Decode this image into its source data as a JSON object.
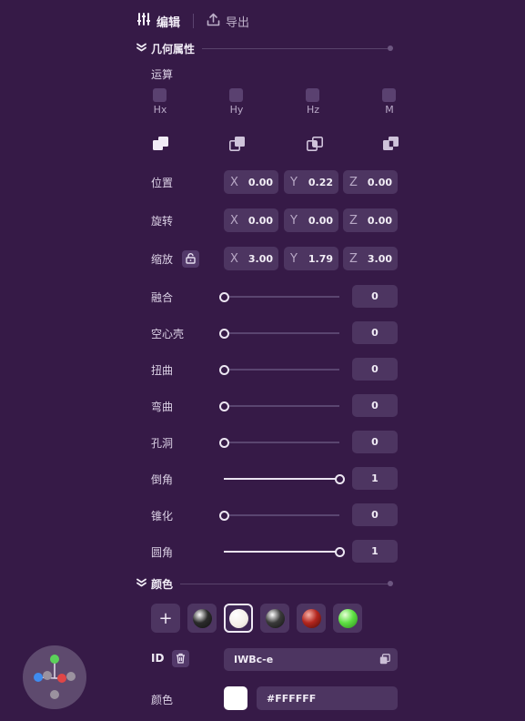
{
  "toolbar": {
    "edit_label": "编辑",
    "export_label": "导出"
  },
  "geometry": {
    "section_title": "几何属性",
    "operations_label": "运算",
    "operations": [
      "Hx",
      "Hy",
      "Hz",
      "M"
    ],
    "position": {
      "label": "位置",
      "x": "0.00",
      "y": "0.22",
      "z": "0.00"
    },
    "rotation": {
      "label": "旋转",
      "x": "0.00",
      "y": "0.00",
      "z": "0.00"
    },
    "scale": {
      "label": "缩放",
      "x": "3.00",
      "y": "1.79",
      "z": "3.00"
    },
    "axes": {
      "x": "X",
      "y": "Y",
      "z": "Z"
    },
    "sliders": [
      {
        "label": "融合",
        "value": "0",
        "level": 0
      },
      {
        "label": "空心壳",
        "value": "0",
        "level": 0
      },
      {
        "label": "扭曲",
        "value": "0",
        "level": 0
      },
      {
        "label": "弯曲",
        "value": "0",
        "level": 0
      },
      {
        "label": "孔洞",
        "value": "0",
        "level": 0
      },
      {
        "label": "倒角",
        "value": "1",
        "level": 1
      },
      {
        "label": "锥化",
        "value": "0",
        "level": 0
      },
      {
        "label": "圆角",
        "value": "1",
        "level": 1
      }
    ]
  },
  "color": {
    "section_title": "颜色",
    "add_label": "+",
    "swatches": [
      {
        "name": "dark-metal",
        "color": "#2b2b2b",
        "selected": false
      },
      {
        "name": "white",
        "color": "#ffffff",
        "selected": true
      },
      {
        "name": "dark-gray",
        "color": "#3a3a3a",
        "selected": false
      },
      {
        "name": "red",
        "color": "#b3261e",
        "selected": false
      },
      {
        "name": "green",
        "color": "#5ee043",
        "selected": false
      }
    ],
    "id_label": "ID",
    "id_value": "IWBc-e",
    "color_label": "颜色",
    "hex_value": "#FFFFFF",
    "current_color": "#FFFFFF"
  },
  "colors": {
    "background": "#361a47",
    "field": "#4d3561",
    "accent_text": "#f2edf7"
  }
}
